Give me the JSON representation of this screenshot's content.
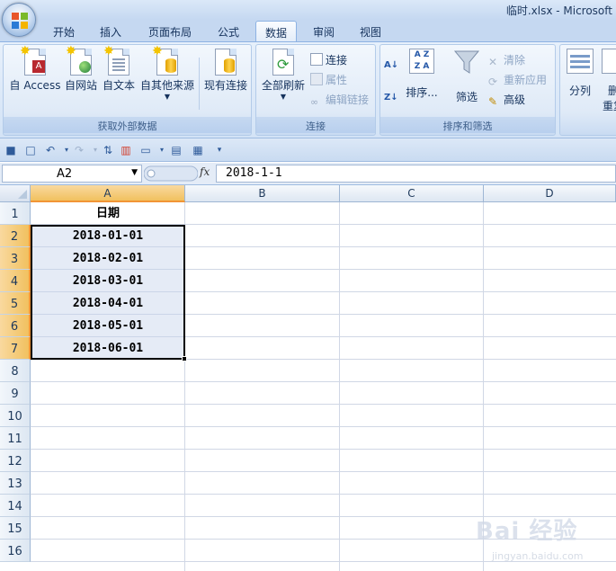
{
  "window": {
    "title": "临时.xlsx - Microsoft"
  },
  "tabs": [
    {
      "label": "开始"
    },
    {
      "label": "插入"
    },
    {
      "label": "页面布局"
    },
    {
      "label": "公式"
    },
    {
      "label": "数据"
    },
    {
      "label": "审阅"
    },
    {
      "label": "视图"
    }
  ],
  "active_tab": "数据",
  "ribbon": {
    "external": {
      "label": "获取外部数据",
      "from_access": "自 Access",
      "from_web": "自网站",
      "from_text": "自文本",
      "from_other": "自其他来源",
      "existing": "现有连接"
    },
    "connections": {
      "label": "连接",
      "refresh_all": "全部刷新",
      "connections": "连接",
      "properties": "属性",
      "edit_links": "编辑链接"
    },
    "sort_filter": {
      "label": "排序和筛选",
      "sort": "排序...",
      "filter": "筛选",
      "clear": "清除",
      "reapply": "重新应用",
      "advanced": "高级"
    },
    "data_tools": {
      "split": "分列",
      "remove_partial_1": "删",
      "remove_partial_2": "重复"
    }
  },
  "formula_bar": {
    "name_box": "A2",
    "fx_label": "fx",
    "formula": "2018-1-1"
  },
  "columns": [
    "A",
    "B",
    "C",
    "D"
  ],
  "rows": [
    "1",
    "2",
    "3",
    "4",
    "5",
    "6",
    "7",
    "8",
    "9",
    "10",
    "11",
    "12",
    "13",
    "14",
    "15",
    "16"
  ],
  "cells": {
    "A1": "日期",
    "A2": "2018-01-01",
    "A3": "2018-02-01",
    "A4": "2018-03-01",
    "A5": "2018-04-01",
    "A6": "2018-05-01",
    "A7": "2018-06-01"
  },
  "watermark": {
    "brand": "Bai 经验",
    "url": "jingyan.baidu.com"
  }
}
